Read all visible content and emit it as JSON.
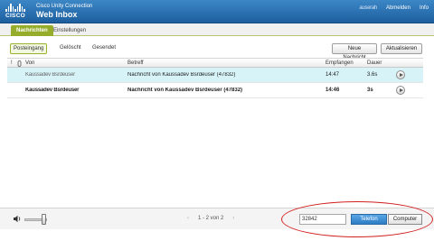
{
  "app": {
    "product": "Cisco Unity Connection",
    "title": "Web Inbox",
    "brand": "CISCO"
  },
  "header": {
    "user": "auserah",
    "logout_label": "Abmelden",
    "info_label": "Info"
  },
  "tabs": [
    {
      "label": "Nachrichten",
      "active": true
    },
    {
      "label": "Einstellungen",
      "active": false
    }
  ],
  "folders": [
    {
      "label": "Posteingang",
      "active": true
    },
    {
      "label": "Gelöscht",
      "active": false
    },
    {
      "label": "Gesendet",
      "active": false
    }
  ],
  "actions": {
    "new_message": "Neue Nachricht",
    "refresh": "Aktualisieren"
  },
  "table": {
    "columns": {
      "flag": "!",
      "from": "Von",
      "subject": "Betreff",
      "received": "Empfangen",
      "duration": "Dauer"
    },
    "rows": [
      {
        "from": "Kaussadev Bsrdeuser",
        "subject": "Nachricht von Kaussadev Bsrdeuser (47832)",
        "received": "14:47",
        "duration": "3.6s",
        "selected": true,
        "unread": false
      },
      {
        "from": "Kaussadev Bsrdeuser",
        "subject": "Nachricht von Kaussadev Bsrdeuser (47832)",
        "received": "14:46",
        "duration": "3s",
        "selected": false,
        "unread": true
      }
    ]
  },
  "footer": {
    "pager_text": "1 - 2 von 2",
    "prev_glyph": "‹",
    "next_glyph": "›",
    "phone_value": "32842",
    "phone_label": "Telefon",
    "computer_label": "Computer",
    "playback_target": "Telefon",
    "volume_level": 0.85
  },
  "colors": {
    "header_blue": "#2a6fb0",
    "tab_green": "#95ad2a",
    "selected_row": "#d7f3f7",
    "phone_button": "#3d8fd6",
    "annotation_red": "#d21f1f"
  },
  "icons": [
    "cisco-logo",
    "flag-icon",
    "attachment-icon",
    "play-icon",
    "volume-icon"
  ]
}
